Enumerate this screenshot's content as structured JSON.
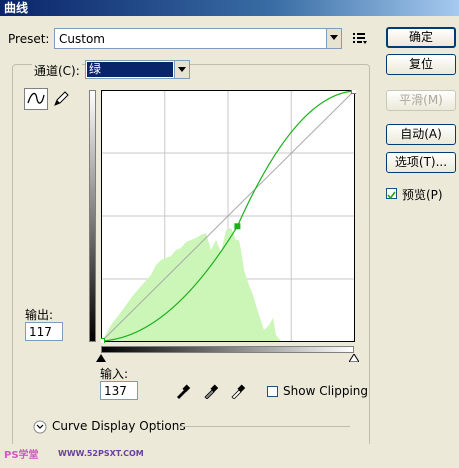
{
  "window": {
    "title": "曲线"
  },
  "preset": {
    "label": "Preset:",
    "value": "Custom"
  },
  "channel": {
    "label": "通道(C):",
    "value": "绿"
  },
  "buttons": {
    "ok": "确定",
    "reset": "复位",
    "smooth": "平滑(M)",
    "auto": "自动(A)",
    "options": "选项(T)..."
  },
  "preview": {
    "label": "预览(P)",
    "checked": true
  },
  "output": {
    "label": "输出:",
    "value": "117"
  },
  "input": {
    "label": "输入:",
    "value": "137"
  },
  "show_clipping": {
    "label": "Show Clipping",
    "checked": false
  },
  "curve_display_options": {
    "label": "Curve Display Options"
  },
  "watermark": {
    "left": "PS学堂",
    "right": "WWW.52PSXT.COM"
  },
  "curve": {
    "points": [
      [
        0,
        0
      ],
      [
        137,
        117
      ],
      [
        255,
        255
      ]
    ],
    "color": "#1ab21a"
  }
}
